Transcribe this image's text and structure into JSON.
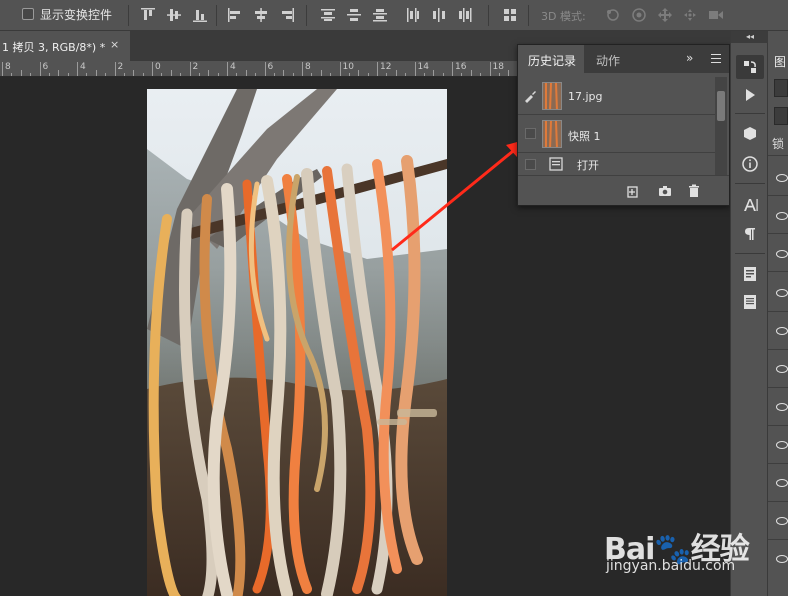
{
  "options_bar": {
    "show_transform_controls": "显示变换控件",
    "mode_3d": "3D 模式:"
  },
  "document": {
    "tab_title": "1 拷贝 3, RGB/8*) *",
    "close": "×"
  },
  "ruler": {
    "labels": [
      "8",
      "6",
      "4",
      "2",
      "0",
      "2",
      "4",
      "6",
      "8",
      "10",
      "12",
      "14",
      "16",
      "18",
      "20"
    ]
  },
  "history_panel": {
    "tab_history": "历史记录",
    "tab_actions": "动作",
    "expand": "»",
    "items": [
      {
        "label": "17.jpg"
      },
      {
        "label": "快照 1"
      },
      {
        "label": "打开"
      }
    ]
  },
  "layers_panel": {
    "title_partial": "图",
    "lock_partial": "锁"
  },
  "watermark": {
    "logo": "Bai🐾经验",
    "url": "jingyan.baidu.com"
  },
  "colors": {
    "panel_bg": "#535353",
    "canvas_bg": "#282828",
    "arrow": "#ff2a1a"
  }
}
